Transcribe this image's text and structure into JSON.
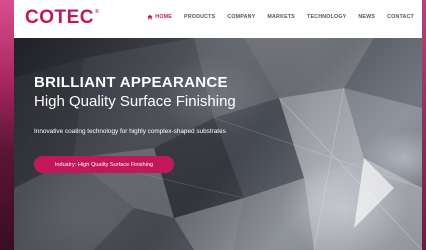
{
  "brand": {
    "name": "COTEC",
    "registered_mark": "®",
    "accent_color": "#c2185b"
  },
  "nav": {
    "items": [
      {
        "label": "HOME",
        "active": true,
        "icon": "home-icon"
      },
      {
        "label": "PRODUCTS",
        "active": false
      },
      {
        "label": "COMPANY",
        "active": false
      },
      {
        "label": "MARKETS",
        "active": false
      },
      {
        "label": "TECHNOLOGY",
        "active": false
      },
      {
        "label": "NEWS",
        "active": false
      },
      {
        "label": "CONTACT",
        "active": false
      }
    ]
  },
  "hero": {
    "title": "BRILLIANT APPEARANCE",
    "subtitle": "High Quality Surface Finishing",
    "description": "Innovative coating technology for highly complex-shaped substrates",
    "button_label": "Industry: High Quality Surface Finishing"
  }
}
